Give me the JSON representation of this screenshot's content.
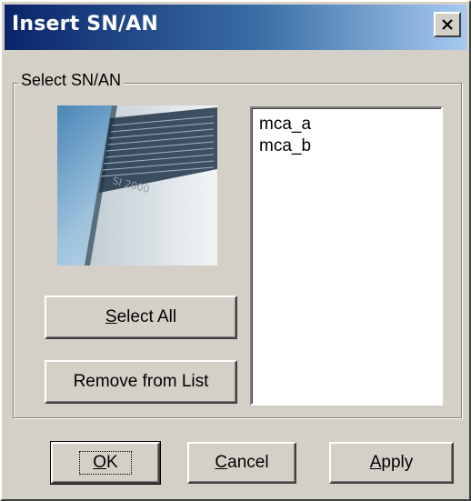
{
  "window": {
    "title": "Insert SN/AN",
    "close_symbol": "✕"
  },
  "group": {
    "label": "Select SN/AN"
  },
  "image": {
    "device_label": "SI 2000",
    "accent_color": "#3a6ea5"
  },
  "list": {
    "items": [
      "mca_a",
      "mca_b"
    ]
  },
  "buttons": {
    "select_all": {
      "mnemonic": "S",
      "rest": "elect All"
    },
    "remove_from_list": "Remove from List",
    "ok": {
      "mnemonic": "O",
      "rest": "K"
    },
    "cancel": {
      "mnemonic": "C",
      "rest": "ancel"
    },
    "apply": {
      "mnemonic": "A",
      "rest": "pply"
    }
  }
}
